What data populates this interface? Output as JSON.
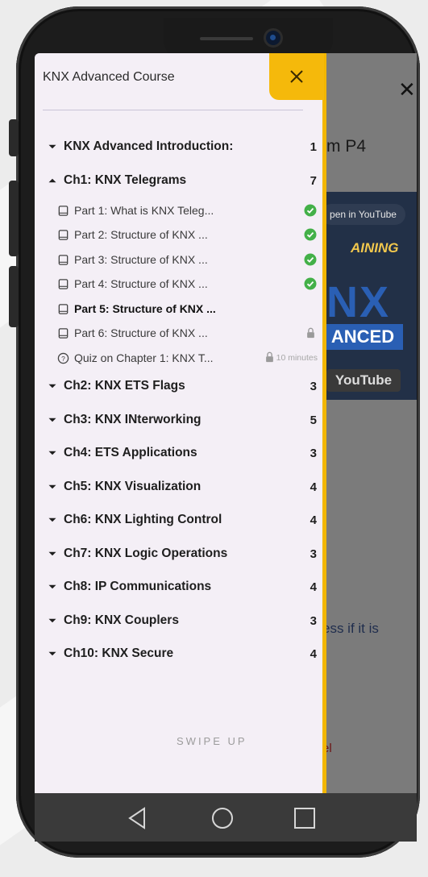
{
  "drawer": {
    "title": "KNX Advanced Course",
    "close_glyph": "✕",
    "swipe_hint": "SWIPE UP",
    "accent_color": "#f5b90b",
    "check_color": "#43b048"
  },
  "chapters": [
    {
      "title": "KNX Advanced Introduction:",
      "count": "1",
      "expanded": false
    },
    {
      "title": "Ch1: KNX Telegrams",
      "count": "7",
      "expanded": true
    },
    {
      "title": "Ch2: KNX ETS Flags",
      "count": "3",
      "expanded": false
    },
    {
      "title": "Ch3: KNX INterworking",
      "count": "5",
      "expanded": false
    },
    {
      "title": "Ch4: ETS Applications",
      "count": "3",
      "expanded": false
    },
    {
      "title": "Ch5: KNX Visualization",
      "count": "4",
      "expanded": false
    },
    {
      "title": "Ch6: KNX Lighting Control",
      "count": "4",
      "expanded": false
    },
    {
      "title": "Ch7: KNX Logic Operations",
      "count": "3",
      "expanded": false
    },
    {
      "title": "Ch8: IP Communications",
      "count": "4",
      "expanded": false
    },
    {
      "title": "Ch9: KNX Couplers",
      "count": "3",
      "expanded": false
    },
    {
      "title": "Ch10: KNX Secure",
      "count": "4",
      "expanded": false
    }
  ],
  "lessons": [
    {
      "title": "Part 1: What is KNX Teleg...",
      "icon": "book-icon",
      "status": "completed"
    },
    {
      "title": "Part 2: Structure of KNX ...",
      "icon": "book-icon",
      "status": "completed"
    },
    {
      "title": "Part 3: Structure of KNX ...",
      "icon": "book-icon",
      "status": "completed"
    },
    {
      "title": "Part 4: Structure of KNX ...",
      "icon": "book-icon",
      "status": "completed"
    },
    {
      "title": "Part 5: Structure of KNX ...",
      "icon": "book-icon",
      "status": "current"
    },
    {
      "title": "Part 6: Structure of KNX ...",
      "icon": "book-icon",
      "status": "locked"
    },
    {
      "title": "Quiz on Chapter 1: KNX T...",
      "icon": "quiz-icon",
      "status": "locked",
      "duration": "10 minutes"
    }
  ],
  "background": {
    "title_fragment": "m P4",
    "open_in_youtube": "pen in YouTube",
    "training": "AINING",
    "knx": "NX",
    "advanced": "ANCED",
    "youtube": "YouTube",
    "text_fragment": "ess if it is",
    "red_fragment": "el"
  }
}
